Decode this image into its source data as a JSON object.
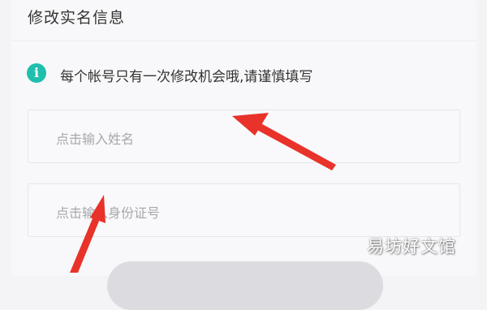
{
  "title": "修改实名信息",
  "notice": {
    "icon": "info-icon",
    "icon_glyph": "i",
    "text": "每个帐号只有一次修改机会哦,请谨慎填写"
  },
  "fields": {
    "name_placeholder": "点击输入姓名",
    "id_placeholder": "点击输入身份证号"
  },
  "watermark": "易坊好文馆",
  "colors": {
    "accent": "#1fbfad",
    "arrow": "#e8322a"
  }
}
